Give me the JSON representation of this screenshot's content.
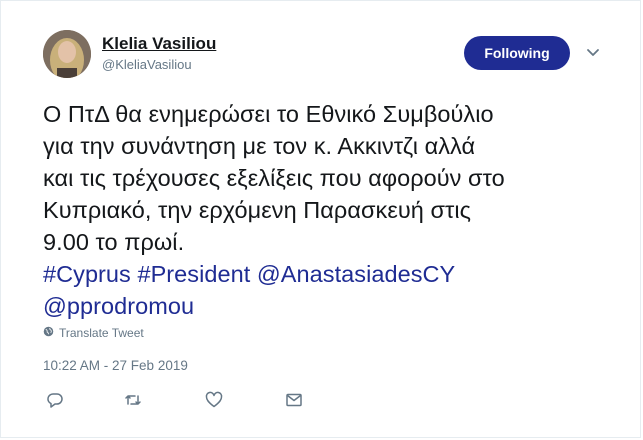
{
  "tweet": {
    "author": {
      "display_name": "Klelia Vasiliou",
      "handle": "@KleliaVasiliou"
    },
    "follow_button_label": "Following",
    "text_lines": [
      "Ο ΠτΔ θα ενημερώσει το Εθνικό Συμβούλιο",
      "για την συνάντηση με τον κ. Ακκιντζι αλλά",
      "και τις τρέχουσες εξελίξεις που αφορούν στο",
      "Κυπριακό, την ερχόμενη Παρασκευή στις",
      "9.00 το πρωί."
    ],
    "links": {
      "hashtag_cyprus": "#Cyprus",
      "hashtag_president": "#President",
      "mention_anastasiades": "@AnastasiadesCY",
      "mention_pprodromou": "@pprodromou"
    },
    "translate_label": "Translate Tweet",
    "timestamp": "10:22 AM - 27 Feb 2019"
  },
  "icons": {
    "caret": "chevron-down-icon",
    "globe": "globe-icon",
    "reply": "reply-icon",
    "retweet": "retweet-icon",
    "like": "heart-icon",
    "message": "envelope-icon"
  },
  "colors": {
    "follow_button_bg": "#1f2c93",
    "link": "#1f2c93",
    "secondary_text": "#657786",
    "text": "#14171a"
  }
}
